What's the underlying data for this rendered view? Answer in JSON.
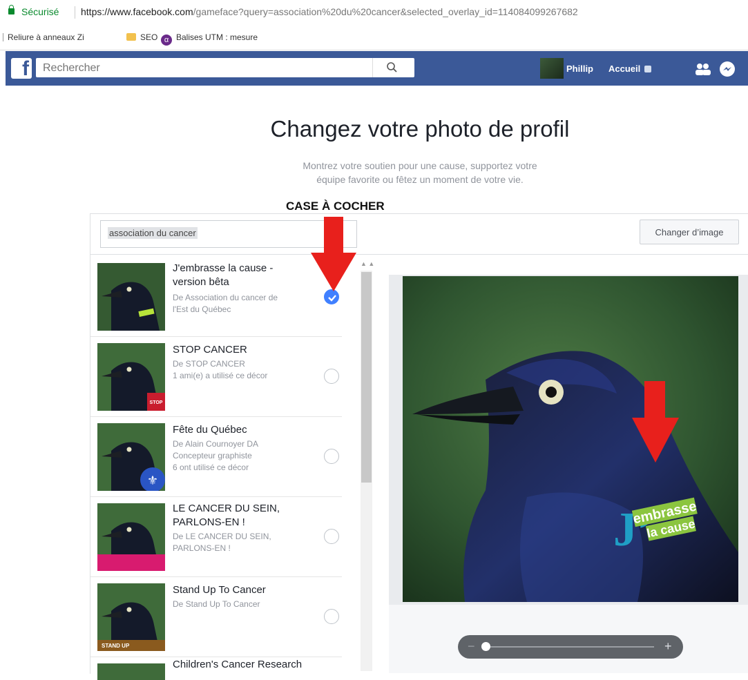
{
  "browser": {
    "secure_label": "Sécurisé",
    "url_host": "https://www.facebook.com",
    "url_path": "/gameface?query=association%20du%20cancer&selected_overlay_id=114084099267682"
  },
  "bookmarks": [
    {
      "label": "Reliure à anneaux Zi",
      "icon": "page-icon"
    },
    {
      "label": "SEO",
      "icon": "folder-icon"
    },
    {
      "label": "Balises UTM : mesure",
      "icon": "alpha-icon"
    }
  ],
  "fbbar": {
    "search_placeholder": "Rechercher",
    "user_name": "Phillip",
    "home_label": "Accueil",
    "colors": {
      "bar": "#3b5998"
    }
  },
  "page": {
    "title": "Changez votre photo de profil",
    "subtitle_line1": "Montrez votre soutien pour une cause, supportez votre",
    "subtitle_line2": "équipe favorite ou fêtez un moment de votre vie.",
    "annotation": "CASE À COCHER"
  },
  "search": {
    "value": "association du cancer"
  },
  "change_image_label": "Changer d’image",
  "frames": [
    {
      "title_lines": [
        "J'embrasse la cause -",
        "version bêta"
      ],
      "sub_lines": [
        "De Association du cancer de",
        "l'Est du Québec"
      ],
      "selected": true
    },
    {
      "title_lines": [
        "STOP CANCER"
      ],
      "sub_lines": [
        "De STOP CANCER",
        "1 ami(e) a utilisé ce décor"
      ],
      "selected": false
    },
    {
      "title_lines": [
        "Fête du Québec"
      ],
      "sub_lines": [
        "De Alain Cournoyer DA",
        "Concepteur graphiste",
        "6 ont utilisé ce décor"
      ],
      "selected": false
    },
    {
      "title_lines": [
        "LE CANCER DU SEIN,",
        "PARLONS-EN !"
      ],
      "sub_lines": [
        "De LE CANCER DU SEIN,",
        "PARLONS-EN !"
      ],
      "selected": false
    },
    {
      "title_lines": [
        "Stand Up To Cancer"
      ],
      "sub_lines": [
        "De Stand Up To Cancer"
      ],
      "selected": false
    },
    {
      "title_lines": [
        "Children's Cancer Research"
      ],
      "sub_lines": [],
      "selected": false
    }
  ],
  "overlay": {
    "line1": "J’",
    "line2": "embrasse",
    "line3": "la cause"
  },
  "thumb_badges": {
    "stop": "STOP",
    "standup": "STAND UP"
  },
  "colors": {
    "accent": "#4080ff",
    "arrow": "#e8201c"
  }
}
